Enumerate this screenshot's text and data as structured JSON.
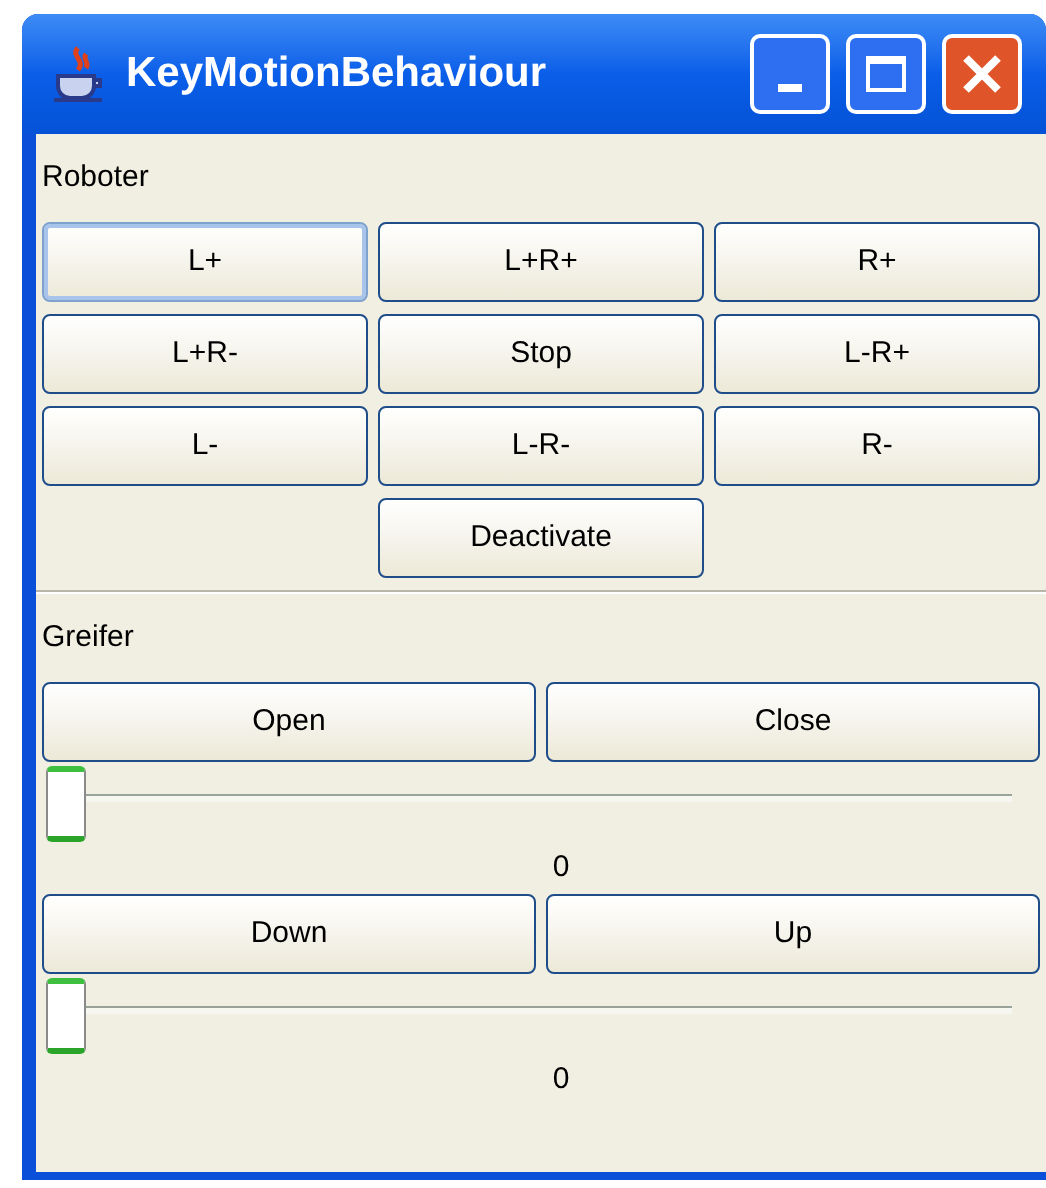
{
  "window": {
    "title": "KeyMotionBehaviour"
  },
  "roboter": {
    "label": "Roboter",
    "buttons": [
      {
        "label": "L+",
        "focused": true
      },
      {
        "label": "L+R+",
        "focused": false
      },
      {
        "label": "R+",
        "focused": false
      },
      {
        "label": "L+R-",
        "focused": false
      },
      {
        "label": "Stop",
        "focused": false
      },
      {
        "label": "L-R+",
        "focused": false
      },
      {
        "label": "L-",
        "focused": false
      },
      {
        "label": "L-R-",
        "focused": false
      },
      {
        "label": "R-",
        "focused": false
      }
    ],
    "deactivate": "Deactivate"
  },
  "greifer": {
    "label": "Greifer",
    "groups": [
      {
        "buttons": [
          "Open",
          "Close"
        ],
        "slider": {
          "level": 0,
          "reading": "0"
        }
      },
      {
        "buttons": [
          "Down",
          "Up"
        ],
        "slider": {
          "level": 0,
          "reading": "0"
        }
      }
    ]
  }
}
